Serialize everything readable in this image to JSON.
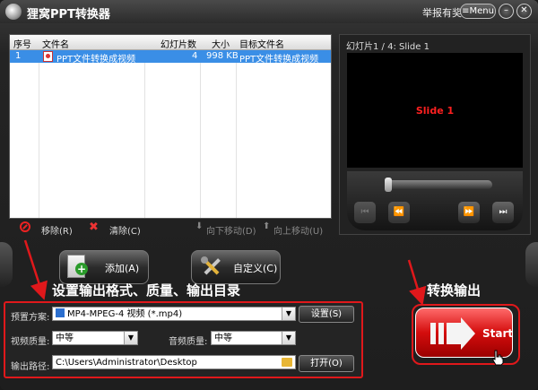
{
  "window": {
    "title": "狸窝PPT转换器",
    "report": "举报有奖",
    "menu": "Menu",
    "minimize": "–",
    "close": "✕"
  },
  "filelist": {
    "headers": [
      "序号",
      "文件名",
      "幻灯片数",
      "大小",
      "目标文件名"
    ],
    "rows": [
      {
        "index": "1",
        "name": "PPT文件转换成视频",
        "slides": "4",
        "size": "998 KB",
        "target": "PPT文件转换成视频"
      }
    ]
  },
  "list_tools": {
    "remove": "移除(R)",
    "clear": "清除(C)",
    "move_down": "向下移动(D)",
    "move_up": "向上移动(U)"
  },
  "preview": {
    "title": "幻灯片1 / 4: Slide 1",
    "slide_text": "Slide 1"
  },
  "buttons": {
    "add": "添加(A)",
    "custom": "自定义(C)",
    "settings": "设置(S)",
    "open": "打开(O)",
    "start": "Start"
  },
  "annotations": {
    "settings_note": "设置输出格式、质量、输出目录",
    "convert_note": "转换输出"
  },
  "settings": {
    "preset_label": "预置方案:",
    "preset_value": "MP4-MPEG-4 视频 (*.mp4)",
    "video_quality_label": "视频质量:",
    "video_quality_value": "中等",
    "audio_quality_label": "音频质量:",
    "audio_quality_value": "中等",
    "output_path_label": "输出路径:",
    "output_path_value": "C:\\Users\\Administrator\\Desktop"
  },
  "colors": {
    "accent_red": "#e0181b",
    "selection_blue": "#3a8ee6"
  }
}
